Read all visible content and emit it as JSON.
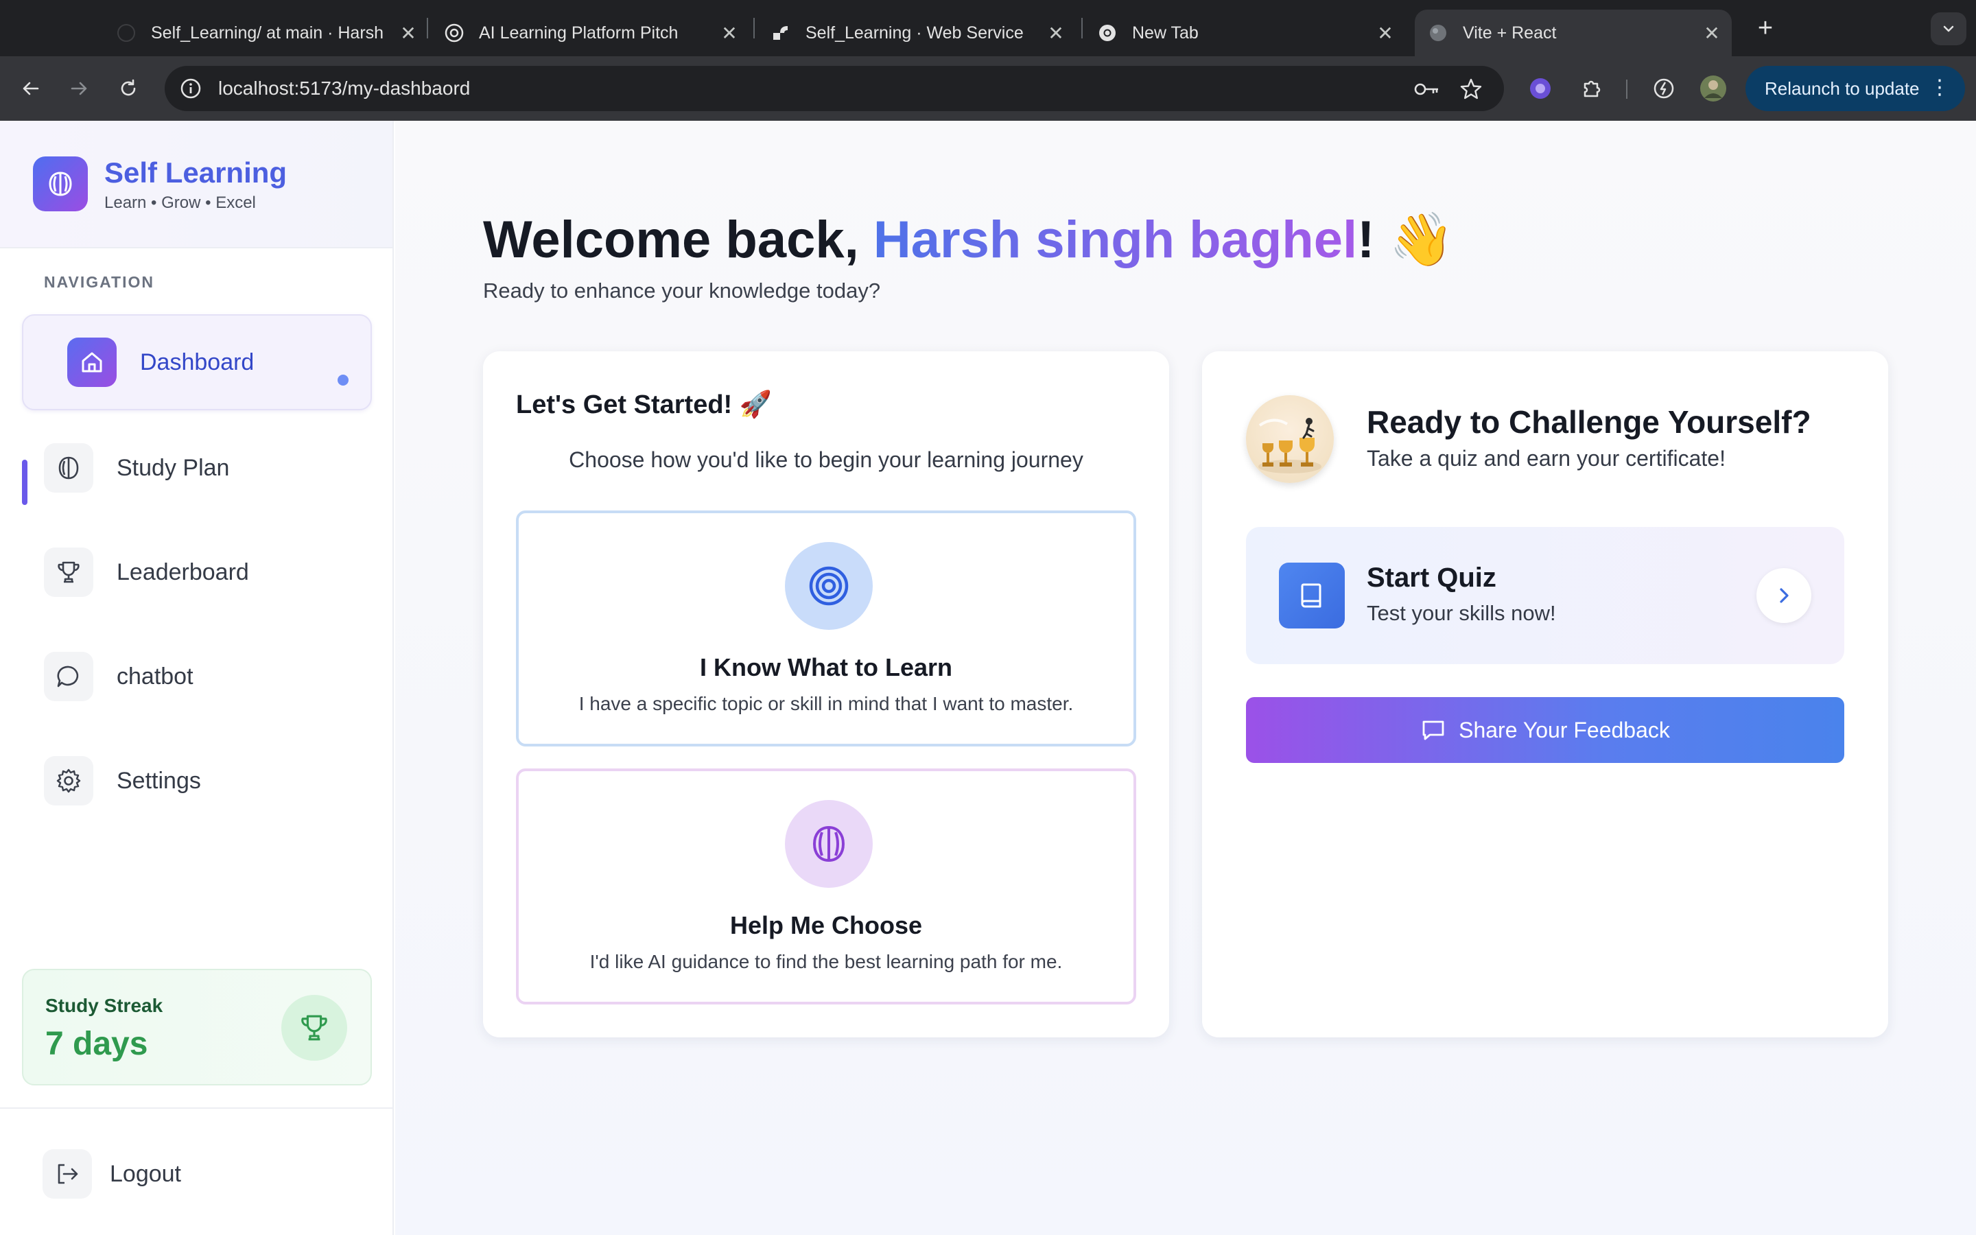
{
  "browser": {
    "tabs": [
      {
        "title": "Self_Learning/ at main · Harsh"
      },
      {
        "title": "AI Learning Platform Pitch"
      },
      {
        "title": "Self_Learning · Web Service"
      },
      {
        "title": "New Tab"
      },
      {
        "title": "Vite + React"
      }
    ],
    "url": "localhost:5173/my-dashbaord",
    "relaunch_label": "Relaunch to update"
  },
  "sidebar": {
    "brand_name": "Self Learning",
    "brand_tagline": "Learn • Grow • Excel",
    "nav_label": "NAVIGATION",
    "items": [
      {
        "label": "Dashboard",
        "icon": "home-icon",
        "active": true
      },
      {
        "label": "Study Plan",
        "icon": "brain-icon"
      },
      {
        "label": "Leaderboard",
        "icon": "trophy-icon"
      },
      {
        "label": "chatbot",
        "icon": "chat-icon"
      },
      {
        "label": "Settings",
        "icon": "gear-icon"
      }
    ],
    "streak": {
      "label": "Study Streak",
      "value": "7 days"
    },
    "logout_label": "Logout"
  },
  "main": {
    "welcome_prefix": "Welcome back, ",
    "user_name": "Harsh singh baghel",
    "welcome_suffix": "! 👋",
    "subtitle": "Ready to enhance your knowledge today?",
    "get_started": {
      "title": "Let's Get Started! 🚀",
      "subtitle": "Choose how you'd like to begin your learning journey",
      "options": [
        {
          "title": "I Know What to Learn",
          "desc": "I have a specific topic or skill in mind that I want to master.",
          "icon": "target-icon"
        },
        {
          "title": "Help Me Choose",
          "desc": "I'd like AI guidance to find the best learning path for me.",
          "icon": "brain-icon"
        }
      ]
    },
    "challenge": {
      "title": "Ready to Challenge Yourself?",
      "subtitle": "Take a quiz and earn your certificate!",
      "quiz_title": "Start Quiz",
      "quiz_subtitle": "Test your skills now!",
      "feedback_label": "Share Your Feedback"
    }
  },
  "colors": {
    "brand_gradient_start": "#4f6ef0",
    "brand_gradient_end": "#9b4de3",
    "streak_green": "#2f9a4e",
    "relaunch_bg": "#0b3d65"
  }
}
